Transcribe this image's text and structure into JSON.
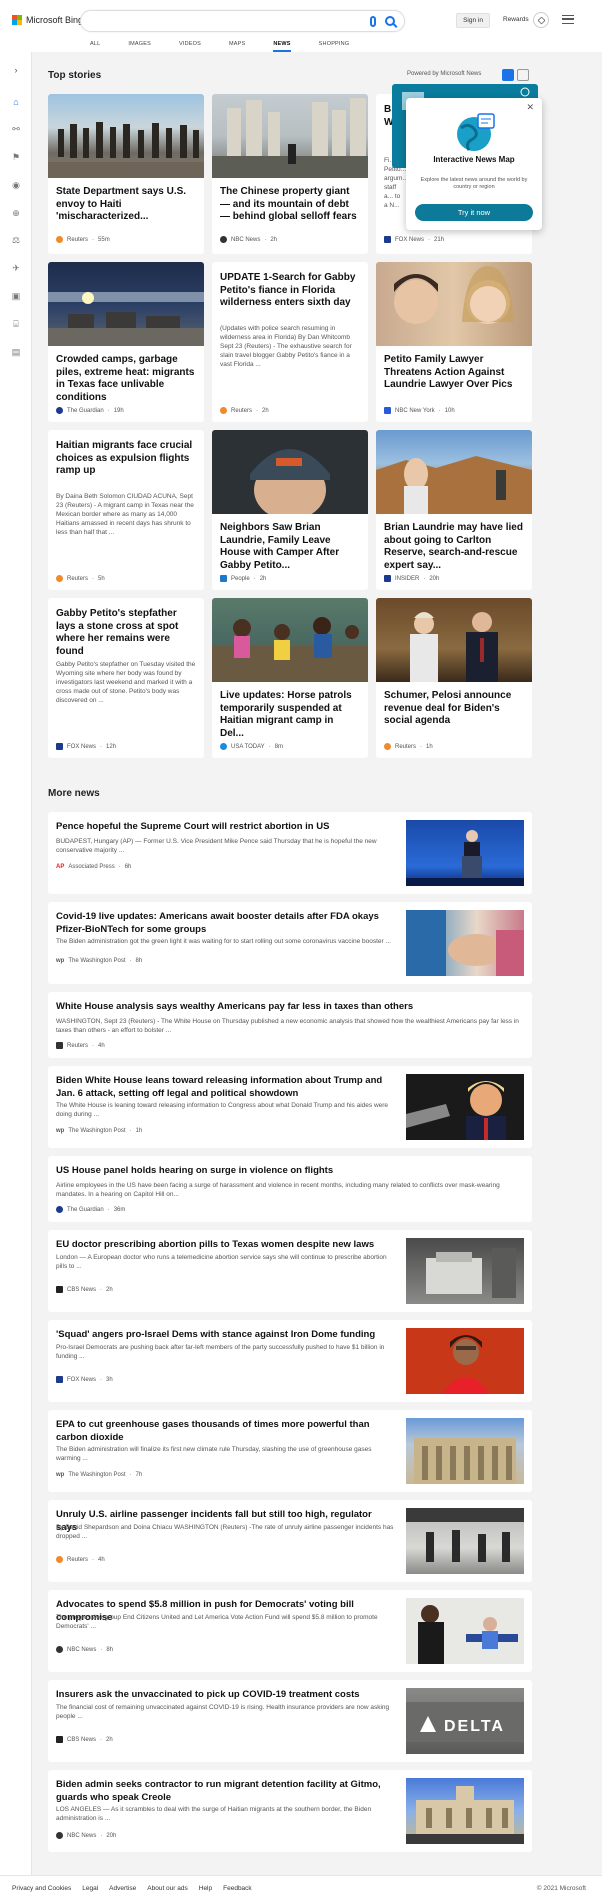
{
  "header": {
    "brand": "Microsoft Bing",
    "search_value": "",
    "signin": "Sign in",
    "rewards": "Rewards",
    "tabs": [
      "ALL",
      "IMAGES",
      "VIDEOS",
      "MAPS",
      "NEWS",
      "SHOPPING"
    ]
  },
  "top_stories": {
    "title": "Top stories",
    "powered_by": "Powered by Microsoft News",
    "map_popup": {
      "title": "Interactive News Map",
      "desc": "Explore the latest news around the world by country or region",
      "button": "Try it now"
    },
    "cards": [
      {
        "title": "State Department says U.S. envoy to Haiti 'mischaracterized...",
        "snippet": "",
        "source": "Reuters",
        "time": "55m"
      },
      {
        "title": "The Chinese property giant — and its mountain of debt — behind global selloff fears",
        "snippet": "",
        "source": "NBC News",
        "time": "2h"
      },
      {
        "title": "B... W...",
        "snippet": "Fi... Petito... argum... staff a... to a N...",
        "source": "FOX News",
        "time": "21h"
      },
      {
        "title": "Crowded camps, garbage piles, extreme heat: migrants in Texas face unlivable conditions",
        "snippet": "",
        "source": "The Guardian",
        "time": "19h"
      },
      {
        "title": "UPDATE 1-Search for Gabby Petito's fiance in Florida wilderness enters sixth day",
        "snippet": "(Updates with police search resuming in wilderness area in Florida) By Dan Whitcomb Sept 23 (Reuters) - The exhaustive search for slain travel blogger Gabby Petito's fiance in a vast Florida ...",
        "source": "Reuters",
        "time": "2h"
      },
      {
        "title": "Petito Family Lawyer Threatens Action Against Laundrie Lawyer Over Pics",
        "snippet": "",
        "source": "NBC New York",
        "time": "10h"
      },
      {
        "title": "Haitian migrants face crucial choices as expulsion flights ramp up",
        "snippet": "By Daina Beth Solomon CIUDAD ACUNA, Sept 23 (Reuters) - A migrant camp in Texas near the Mexican border where as many as 14,000 Haitians amassed in recent days has shrunk to less than half that ...",
        "source": "Reuters",
        "time": "5h"
      },
      {
        "title": "Neighbors Saw Brian Laundrie, Family Leave House with Camper After Gabby Petito...",
        "snippet": "",
        "source": "People",
        "time": "2h"
      },
      {
        "title": "Brian Laundrie may have lied about going to Carlton Reserve, search-and-rescue expert say...",
        "snippet": "",
        "source": "INSIDER",
        "time": "20h"
      },
      {
        "title": "Gabby Petito's stepfather lays a stone cross at spot where her remains were found",
        "snippet": "Gabby Petito's stepfather on Tuesday visited the Wyoming site where her body was found by investigators last weekend and marked it with a cross made out of stone.  Petito's body was discovered on ...",
        "source": "FOX News",
        "time": "12h"
      },
      {
        "title": "Live updates: Horse patrols temporarily suspended at Haitian migrant camp in Del...",
        "snippet": "",
        "source": "USA TODAY",
        "time": "8m"
      },
      {
        "title": "Schumer, Pelosi announce revenue deal for Biden's social agenda",
        "snippet": "",
        "source": "Reuters",
        "time": "1h"
      }
    ]
  },
  "more_news": {
    "title": "More news",
    "items": [
      {
        "title": "Pence hopeful the Supreme Court will restrict abortion in US",
        "snippet": "BUDAPEST, Hungary (AP) — Former U.S. Vice President Mike Pence said Thursday that he is hopeful the new conservative majority ...",
        "source": "Associated Press",
        "time": "6h"
      },
      {
        "title": "Covid-19 live updates: Americans await booster details after FDA okays Pfizer-BioNTech for some groups",
        "snippet": "The Biden administration got the green light it was waiting for to start rolling out some coronavirus vaccine booster ...",
        "source": "The Washington Post",
        "time": "8h"
      },
      {
        "title": "White House analysis says wealthy Americans pay far less in taxes than others",
        "snippet": "WASHINGTON, Sept 23 (Reuters) - The White House on Thursday published a new economic analysis that showed how the wealthiest Americans pay far less in taxes than others - an effort to bolster ...",
        "source": "Reuters",
        "time": "4h"
      },
      {
        "title": "Biden White House leans toward releasing information about Trump and Jan. 6 attack, setting off legal and political showdown",
        "snippet": "The White House is leaning toward releasing information to Congress about what Donald Trump and his aides were doing during ...",
        "source": "The Washington Post",
        "time": "1h"
      },
      {
        "title": "US House panel holds hearing on surge in violence on flights",
        "snippet": "Airline employees in the US have been facing a surge of harassment and violence in recent months, including many related to conflicts over mask-wearing mandates. In a hearing on Capitol Hill on...",
        "source": "The Guardian",
        "time": "36m"
      },
      {
        "title": "EU doctor prescribing abortion pills to Texas women despite new laws",
        "snippet": "London — A European doctor who runs a telemedicine abortion service says she will continue to prescribe abortion pills to ...",
        "source": "CBS News",
        "time": "2h"
      },
      {
        "title": "'Squad' angers pro-Israel Dems with stance against Iron Dome funding",
        "snippet": "Pro-Israel Democrats are pushing back after far-left members of the party successfully pushed to have $1 billion in funding ...",
        "source": "FOX News",
        "time": "3h"
      },
      {
        "title": "EPA to cut greenhouse gases thousands of times more powerful than carbon dioxide",
        "snippet": "The Biden administration will finalize its first new climate rule Thursday, slashing the use of greenhouse gases warming ...",
        "source": "The Washington Post",
        "time": "7h"
      },
      {
        "title": "Unruly U.S. airline passenger incidents fall but still too high, regulator says",
        "snippet": "By David Shepardson and Doina Chiacu WASHINGTON (Reuters) -The rate of unruly airline passenger incidents has dropped ...",
        "source": "Reuters",
        "time": "4h"
      },
      {
        "title": "Advocates to spend $5.8 million in push for Democrats' voting bill compromise",
        "snippet": "The progressive group End Citizens United and Let America Vote Action Fund will spend $5.8 million to promote Democrats' ...",
        "source": "NBC News",
        "time": "8h"
      },
      {
        "title": "Insurers ask the unvaccinated to pick up COVID-19 treatment costs",
        "snippet": "The financial cost of remaining unvaccinated against COVID-19 is rising. Health insurance providers are now asking people ...",
        "source": "CBS News",
        "time": "2h",
        "image_text": "DELTA"
      },
      {
        "title": "Biden admin seeks contractor to run migrant detention facility at Gitmo, guards who speak Creole",
        "snippet": "LOS ANGELES — As it scrambles to deal with the surge of Haitian migrants at the southern border, the Biden administration is ...",
        "source": "NBC News",
        "time": "20h"
      }
    ]
  },
  "footer": {
    "links": [
      "Privacy and Cookies",
      "Legal",
      "Advertise",
      "About our ads",
      "Help",
      "Feedback"
    ],
    "copyright": "© 2021 Microsoft"
  }
}
